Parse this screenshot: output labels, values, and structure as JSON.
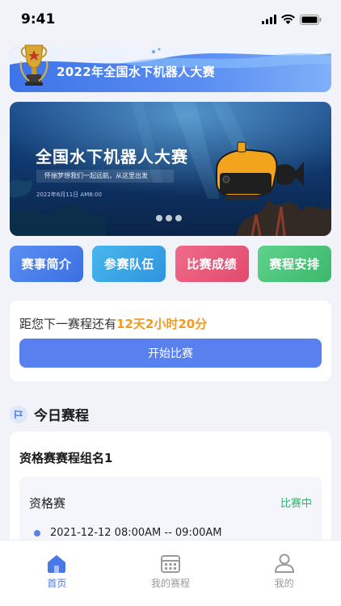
{
  "status_bar": {
    "time": "9:41"
  },
  "header": {
    "title": "2022年全国水下机器人大赛"
  },
  "hero": {
    "title": "全国水下机器人大赛",
    "subtitle": "怀揣梦想我们一起远航，从这里出发",
    "date": "2022年6月11日 AM8:00",
    "page_count": 3
  },
  "quick_actions": [
    {
      "label": "赛事简介"
    },
    {
      "label": "参赛队伍"
    },
    {
      "label": "比赛成绩"
    },
    {
      "label": "赛程安排"
    }
  ],
  "countdown": {
    "prefix": "距您下一赛程还有",
    "remaining": "12天2小时20分",
    "button_label": "开始比赛"
  },
  "today": {
    "section_title": "今日赛程",
    "group_name": "资格赛赛程组名1",
    "stage": {
      "name": "资格赛",
      "status": "比赛中",
      "time": "2021-12-12  08:00AM -- 09:00AM"
    }
  },
  "tab_bar": {
    "items": [
      {
        "label": "首页",
        "active": true
      },
      {
        "label": "我的赛程",
        "active": false
      },
      {
        "label": "我的",
        "active": false
      }
    ]
  },
  "colors": {
    "accent": "#5880ee",
    "highlight": "#f39a1e",
    "status_active": "#2fb36a"
  }
}
